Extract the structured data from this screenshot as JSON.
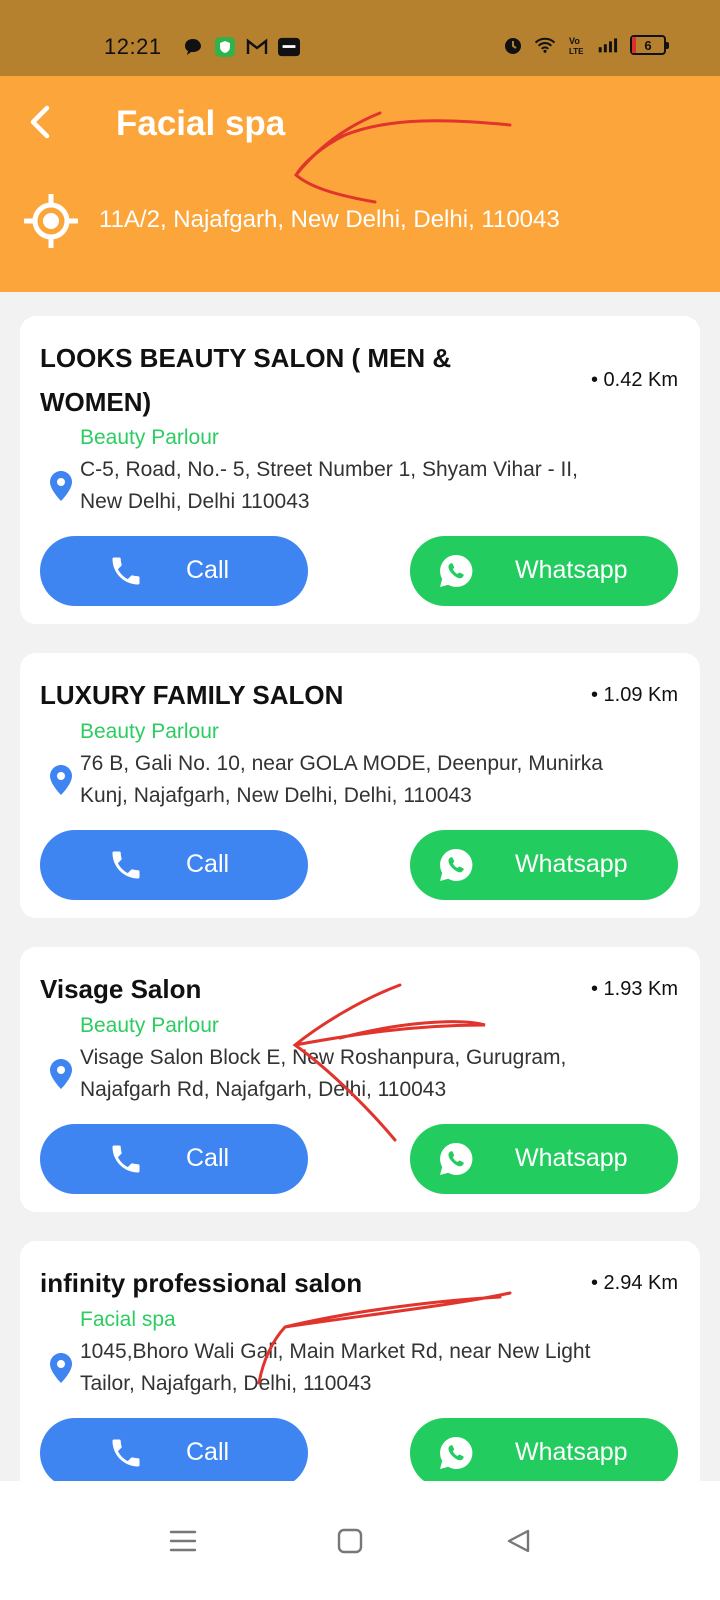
{
  "status_bar": {
    "time": "12:21",
    "left_icons": [
      "chat-bubble-icon",
      "shield-app-icon",
      "gmail-icon",
      "paytm-icon"
    ],
    "right_icons": [
      "alarm-icon",
      "wifi-icon",
      "volte-icon",
      "signal-icon"
    ],
    "battery": "6"
  },
  "header": {
    "title": "Facial spa",
    "address": "11A/2, Najafgarh, New Delhi, Delhi, 110043",
    "color": "#fca53a"
  },
  "listings": [
    {
      "name_lines": [
        "LOOKS BEAUTY SALON ( MEN &",
        "WOMEN)"
      ],
      "distance": "• 0.42 Km",
      "category": "Beauty Parlour",
      "address_lines": [
        "C-5, Road, No.- 5, Street Number 1, Shyam Vihar - II,",
        "New Delhi, Delhi 110043"
      ],
      "call_label": "Call",
      "whatsapp_label": "Whatsapp"
    },
    {
      "name_lines": [
        "LUXURY FAMILY SALON"
      ],
      "distance": "• 1.09 Km",
      "category": "Beauty Parlour",
      "address_lines": [
        "76 B, Gali No. 10, near GOLA MODE, Deenpur, Munirka",
        "Kunj, Najafgarh, New Delhi, Delhi, 110043"
      ],
      "call_label": "Call",
      "whatsapp_label": "Whatsapp"
    },
    {
      "name_lines": [
        "Visage Salon"
      ],
      "distance": "• 1.93 Km",
      "category": "Beauty Parlour",
      "address_lines": [
        "Visage Salon Block E, New Roshanpura, Gurugram,",
        "Najafgarh Rd, Najafgarh, Delhi, 110043"
      ],
      "call_label": "Call",
      "whatsapp_label": "Whatsapp"
    },
    {
      "name_lines": [
        "infinity professional salon"
      ],
      "distance": "• 2.94 Km",
      "category": "Facial spa",
      "address_lines": [
        "1045,Bhoro Wali Gali, Main Market Rd, near New Light",
        "Tailor, Najafgarh, Delhi, 110043"
      ],
      "call_label": "Call",
      "whatsapp_label": "Whatsapp"
    }
  ],
  "nav_bar": {
    "items": [
      "menu-icon",
      "home-icon",
      "back-icon"
    ]
  },
  "colors": {
    "status_bar": "#b5812f",
    "call": "#3f85f2",
    "whatsapp": "#22cc5e",
    "category": "#2ccd60",
    "annotation": "#e0342c"
  }
}
